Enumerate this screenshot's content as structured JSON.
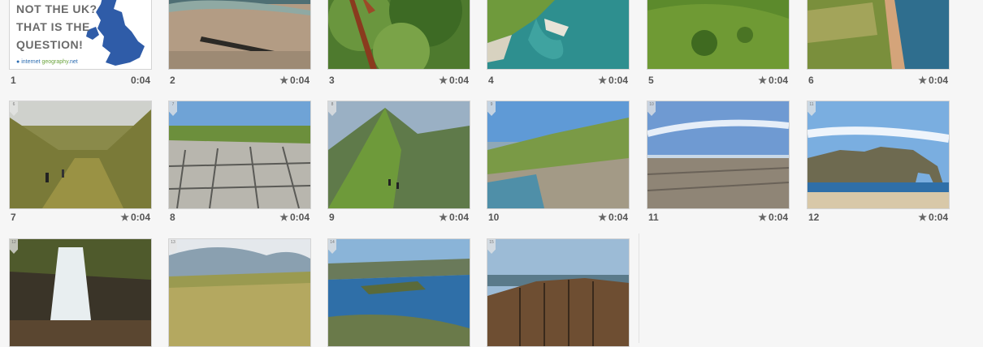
{
  "slides": [
    {
      "number": "1",
      "duration": "0:04",
      "starred": false
    },
    {
      "number": "2",
      "duration": "0:04",
      "starred": true
    },
    {
      "number": "3",
      "duration": "0:04",
      "starred": true
    },
    {
      "number": "4",
      "duration": "0:04",
      "starred": true
    },
    {
      "number": "5",
      "duration": "0:04",
      "starred": true
    },
    {
      "number": "6",
      "duration": "0:04",
      "starred": true
    },
    {
      "number": "7",
      "duration": "0:04",
      "starred": true
    },
    {
      "number": "8",
      "duration": "0:04",
      "starred": true
    },
    {
      "number": "9",
      "duration": "0:04",
      "starred": true
    },
    {
      "number": "10",
      "duration": "0:04",
      "starred": true
    },
    {
      "number": "11",
      "duration": "0:04",
      "starred": true
    },
    {
      "number": "12",
      "duration": "0:04",
      "starred": true
    }
  ],
  "cover": {
    "line1": "NOT THE UK?",
    "line2": "THAT IS THE",
    "line3": "QUESTION!",
    "logo_part1": "internet ",
    "logo_part2": "geography",
    "logo_part3": ".net"
  },
  "badges": [
    "6",
    "7",
    "8",
    "9",
    "10",
    "11",
    "12",
    "13",
    "14",
    "15"
  ],
  "star_glyph": "★",
  "colors": {
    "background": "#f6f6f6",
    "map_blue": "#2f5ca8"
  }
}
